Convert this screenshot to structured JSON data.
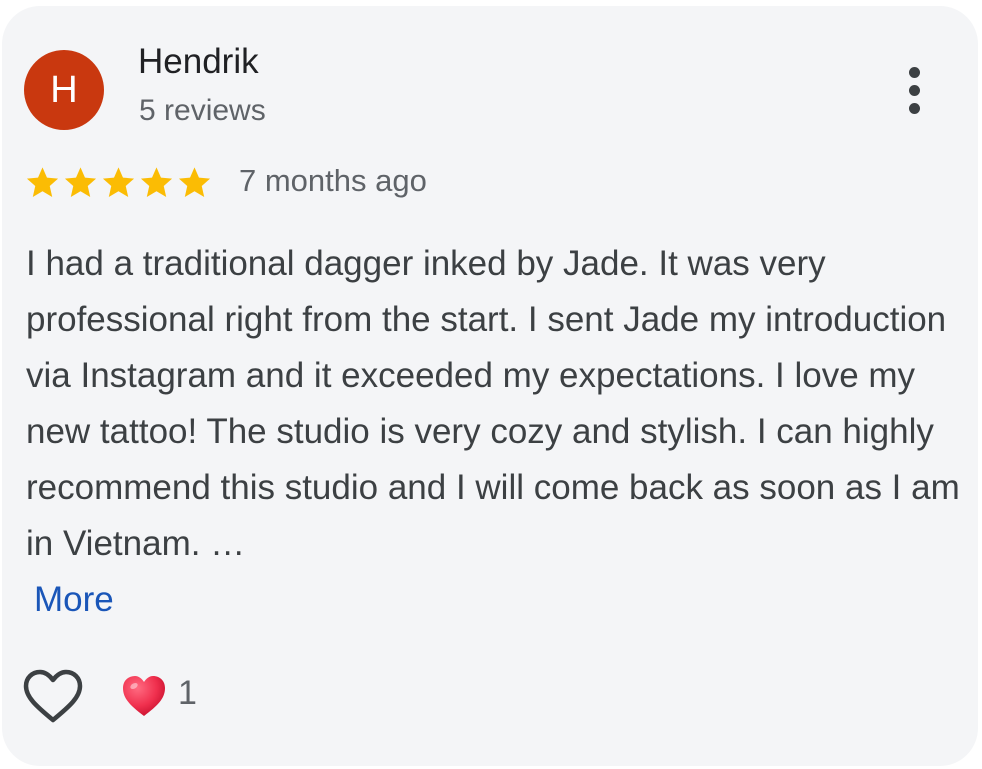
{
  "review": {
    "author": {
      "initial": "H",
      "name": "Hendrik",
      "review_count": "5 reviews"
    },
    "rating": 5,
    "rating_max": 5,
    "date": "7 months ago",
    "text": "I had a traditional dagger inked by Jade. It was very professional right from the start. I sent Jade my introduction via Instagram and it exceeded my expectations. I love my new tattoo! The studio is very cozy and stylish. I can highly recommend this studio and I will come back as soon as I am in Vietnam. …",
    "more_label": "More",
    "reactions": {
      "heart_count": "1"
    }
  },
  "icons": {
    "menu": "more-vertical-icon",
    "star": "star-icon",
    "like": "heart-outline-icon",
    "reaction": "red-heart-icon"
  },
  "colors": {
    "card_background": "#f4f5f7",
    "avatar": "#c9380f",
    "star": "#fbbc04",
    "link": "#1a56b8",
    "reaction_heart": "#f0304e"
  }
}
